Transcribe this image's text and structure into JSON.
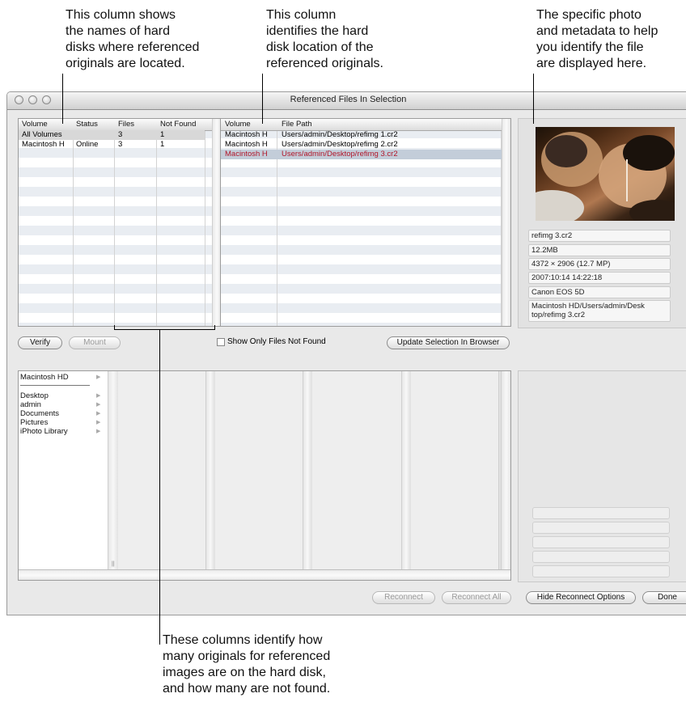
{
  "callouts": {
    "volume_col": [
      "This column shows",
      "the names of hard",
      "disks where referenced",
      "originals are located."
    ],
    "location_col": [
      "This column",
      "identifies the hard",
      "disk location of the",
      "referenced originals."
    ],
    "photo_meta": [
      "The specific photo",
      "and metadata to help",
      "you identify the file",
      "are displayed here."
    ],
    "count_cols": [
      "These columns identify how",
      "many originals for referenced",
      "images are on the hard disk,",
      "and how many are not found."
    ]
  },
  "window": {
    "title": "Referenced Files In Selection"
  },
  "volumes_table": {
    "headers": [
      "Volume",
      "Status",
      "Files",
      "Not Found"
    ],
    "rows": [
      {
        "volume": "All Volumes",
        "status": "",
        "files": "3",
        "not_found": "1"
      },
      {
        "volume": "Macintosh H",
        "status": "Online",
        "files": "3",
        "not_found": "1"
      }
    ]
  },
  "files_table": {
    "headers": [
      "Volume",
      "File Path"
    ],
    "rows": [
      {
        "volume": "Macintosh H",
        "path": "Users/admin/Desktop/refimg 1.cr2"
      },
      {
        "volume": "Macintosh H",
        "path": "Users/admin/Desktop/refimg 2.cr2"
      },
      {
        "volume": "Macintosh H",
        "path": "Users/admin/Desktop/refimg 3.cr2"
      }
    ]
  },
  "metadata": {
    "filename": "refimg 3.cr2",
    "size": "12.2MB",
    "dimensions": "4372 × 2906 (12.7 MP)",
    "date": "2007:10:14 14:22:18",
    "camera": "Canon EOS 5D",
    "path_line1": "Macintosh HD/Users/admin/Desk",
    "path_line2": "top/refimg 3.cr2"
  },
  "buttons": {
    "verify": "Verify",
    "mount": "Mount",
    "show_only_not_found": "Show Only Files Not Found",
    "update_selection": "Update Selection In Browser",
    "reconnect": "Reconnect",
    "reconnect_all": "Reconnect All",
    "hide_reconnect": "Hide Reconnect Options",
    "done": "Done"
  },
  "browser": {
    "root": "Macintosh HD",
    "items": [
      "Desktop",
      "admin",
      "Documents",
      "Pictures",
      "iPhoto Library"
    ]
  },
  "colors": {
    "missing_file_text": "#b0162a",
    "selected_row": "#c3cdd9"
  }
}
